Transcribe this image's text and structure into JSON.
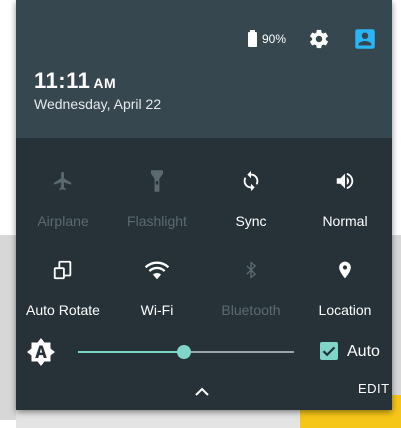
{
  "status": {
    "battery": "90%"
  },
  "clock": {
    "time": "11:11",
    "ampm": "AM",
    "date": "Wednesday, April 22"
  },
  "tiles": [
    {
      "label": "Airplane",
      "icon": "airplane-icon",
      "state": "off"
    },
    {
      "label": "Flashlight",
      "icon": "flashlight-icon",
      "state": "off"
    },
    {
      "label": "Sync",
      "icon": "sync-icon",
      "state": "on"
    },
    {
      "label": "Normal",
      "icon": "volume-icon",
      "state": "on"
    },
    {
      "label": "Auto Rotate",
      "icon": "auto-rotate-icon",
      "state": "on"
    },
    {
      "label": "Wi-Fi",
      "icon": "wifi-icon",
      "state": "on"
    },
    {
      "label": "Bluetooth",
      "icon": "bluetooth-icon",
      "state": "off"
    },
    {
      "label": "Location",
      "icon": "location-icon",
      "state": "on"
    }
  ],
  "brightness": {
    "level": 0.49,
    "auto_label": "Auto",
    "auto_checked": true
  },
  "footer": {
    "edit_label": "EDIT"
  },
  "colors": {
    "header": "#37474f",
    "panel": "#263238",
    "accent": "#7fd6c8",
    "avatar": "#29b6f6",
    "inactive": "#5b6a71"
  }
}
